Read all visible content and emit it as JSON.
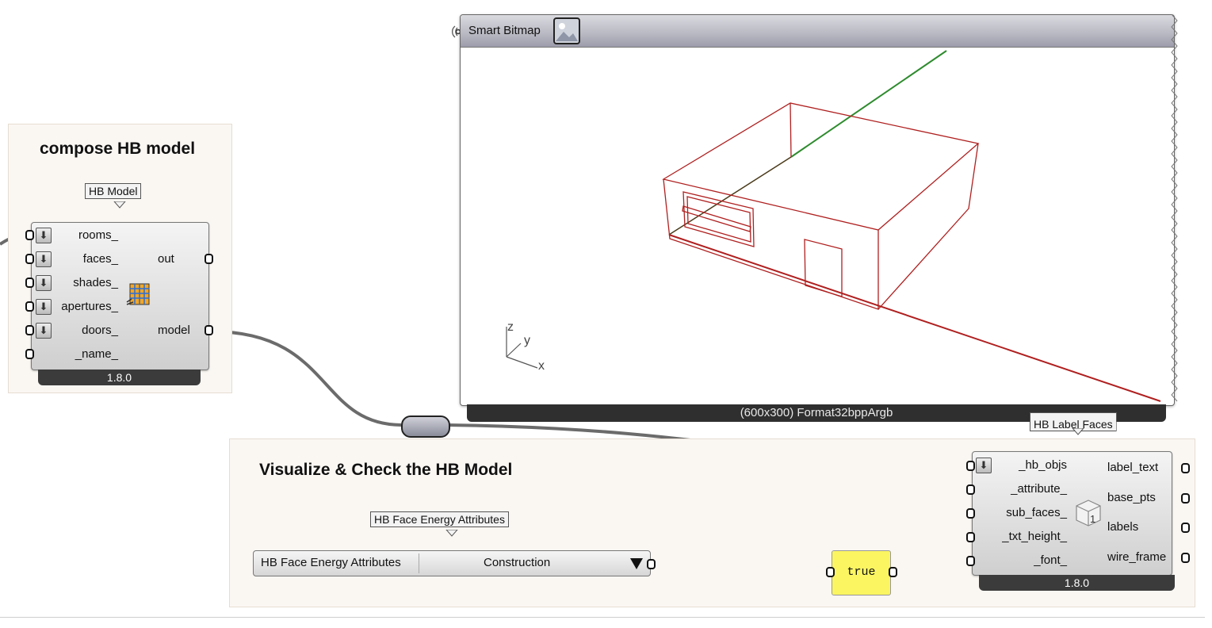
{
  "group_compose": {
    "title": "compose HB model"
  },
  "group_visualize": {
    "title": "Visualize & Check the HB Model"
  },
  "hb_model": {
    "tag": "HB Model",
    "inputs": [
      "rooms_",
      "faces_",
      "shades_",
      "apertures_",
      "doors_",
      "_name_"
    ],
    "outputs": [
      "out",
      "model"
    ],
    "version": "1.8.0",
    "icon": "room-stack-icon"
  },
  "smart_bitmap": {
    "title": "Smart Bitmap",
    "footer": "(600x300) Format32bppArgb",
    "axes": {
      "z": "z",
      "y": "y",
      "x": "x"
    }
  },
  "label_faces": {
    "tag": "HB Label Faces",
    "inputs": [
      "_hb_objs",
      "_attribute_",
      "sub_faces_",
      "_txt_height_",
      "_font_"
    ],
    "outputs": [
      "label_text",
      "base_pts",
      "labels",
      "wire_frame"
    ],
    "version": "1.8.0",
    "icon": "label-cube-icon"
  },
  "energy_attr": {
    "tag": "HB Face Energy Attributes",
    "label": "HB Face Energy Attributes",
    "value": "Construction"
  },
  "toggle": {
    "value": "true"
  },
  "colors": {
    "group_bg": "#faf7f3",
    "toggle_bg": "#fbf562",
    "model_edges": "#b02020",
    "axis_line": "#2e8b2e",
    "wire": "#6b6b6b"
  }
}
